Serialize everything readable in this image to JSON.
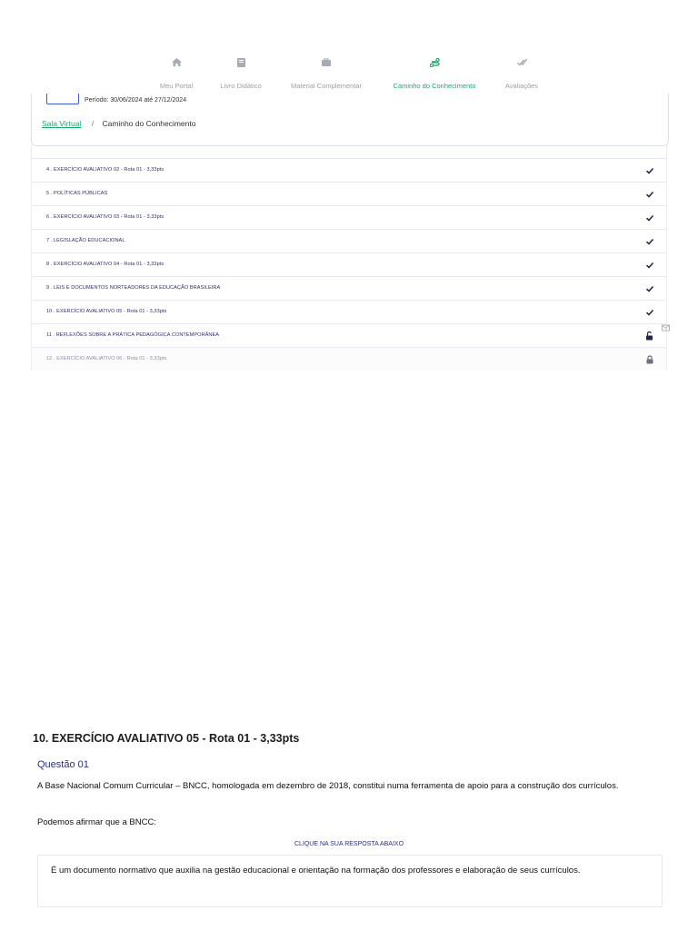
{
  "nav": {
    "items": [
      {
        "label": "Meu Portal",
        "icon": "home-icon",
        "active": false
      },
      {
        "label": "Livro Didático",
        "icon": "book-icon",
        "active": false
      },
      {
        "label": "Material Complementar",
        "icon": "briefcase-icon",
        "active": false
      },
      {
        "label": "Caminho do Conhecimento",
        "icon": "route-icon",
        "active": true
      },
      {
        "label": "Avaliações",
        "icon": "double-check-icon",
        "active": false
      }
    ]
  },
  "header": {
    "period": "Período: 30/06/2024 até 27/12/2024",
    "breadcrumb": {
      "link": "Sala Virtual",
      "separator": "/",
      "current": "Caminho do Conhecimento"
    }
  },
  "steps": [
    {
      "label": "4 . EXERCÍCIO AVALIATIVO 02 - Rota 01 - 3,33pts",
      "status": "done"
    },
    {
      "label": "5 . POLÍTICAS PÚBLICAS",
      "status": "done"
    },
    {
      "label": "6 . EXERCÍCIO AVALIATIVO 03 - Rota 01 - 3,33pts",
      "status": "done"
    },
    {
      "label": "7 . LEGISLAÇÃO EDUCACIONAL",
      "status": "done"
    },
    {
      "label": "8 . EXERCÍCIO AVALIATIVO 04 - Rota 01 - 3,33pts",
      "status": "done"
    },
    {
      "label": "9 . LEIS E DOCUMENTOS NORTEADORES DA EDUCAÇÃO BRASILEIRA",
      "status": "done"
    },
    {
      "label": "10 . EXERCÍCIO AVALIATIVO 05 - Rota 01 - 3,33pts",
      "status": "done"
    },
    {
      "label": "11 . REFLEXÕES SOBRE A PRÁTICA PEDAGÓGICA CONTEMPORÂNEA",
      "status": "unlocked"
    },
    {
      "label": "12 . EXERCÍCIO AVALIATIVO 06 - Rota 01 - 3,33pts",
      "status": "locked"
    }
  ],
  "exercise": {
    "title": "10. EXERCÍCIO AVALIATIVO 05 - Rota 01 - 3,33pts",
    "question_label": "Questão 01",
    "question_text": "A Base Nacional Comum Curricular – BNCC, homologada em dezembro de 2018, constitui numa ferramenta de apoio para a construção dos currículos.",
    "prompt": "Podemos afirmar que a BNCC:",
    "instruction": "CLIQUE NA SUA RESPOSTA ABAIXO",
    "answer": "É um documento normativo que auxilia na gestão educacional e orientação na formação dos professores e elaboração de seus currículos."
  },
  "colors": {
    "accent": "#1aa76b",
    "navy": "#2a2f7a",
    "muted": "#9aa0a6"
  }
}
